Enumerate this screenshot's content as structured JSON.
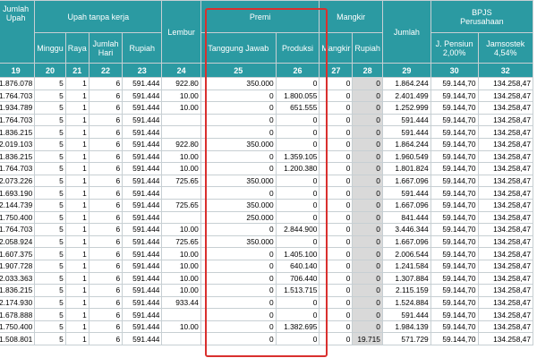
{
  "headers": {
    "jumlah_upah": "Jumlah\nUpah",
    "upah_tanpa_kerja": "Upah tanpa kerja",
    "minggu": "Minggu",
    "raya": "Raya",
    "jumlah_hari": "Jumlah\nHari",
    "rupiah": "Rupiah",
    "lembur": "Lembur",
    "premi": "Premi",
    "tanggung_jawab": "Tanggung Jawab",
    "produksi": "Produksi",
    "mangkir_group": "Mangkir",
    "mangkir": "Mangkir",
    "rupiah_mangkir": "Rupiah",
    "jumlah": "Jumlah",
    "bpjs": "BPJS\nPerusahaan",
    "j_pensiun": "J. Pensiun\n2,00%",
    "jamsostek": "Jamsostek\n4,54%"
  },
  "column_numbers": [
    "19",
    "20",
    "21",
    "22",
    "23",
    "24",
    "25",
    "26",
    "27",
    "28",
    "29",
    "30",
    "32"
  ],
  "rows": [
    [
      "1.876.078",
      "5",
      "1",
      "6",
      "591.444",
      "922.80",
      "350.000",
      "0",
      "0",
      "0",
      "1.864.244",
      "59.144,70",
      "134.258,47"
    ],
    [
      "1.764.703",
      "5",
      "1",
      "6",
      "591.444",
      "10.00",
      "0",
      "1.800.055",
      "0",
      "0",
      "2.401.499",
      "59.144,70",
      "134.258,47"
    ],
    [
      "1.934.789",
      "5",
      "1",
      "6",
      "591.444",
      "10.00",
      "0",
      "651.555",
      "0",
      "0",
      "1.252.999",
      "59.144,70",
      "134.258,47"
    ],
    [
      "1.764.703",
      "5",
      "1",
      "6",
      "591.444",
      "",
      "0",
      "0",
      "0",
      "0",
      "591.444",
      "59.144,70",
      "134.258,47"
    ],
    [
      "1.836.215",
      "5",
      "1",
      "6",
      "591.444",
      "",
      "0",
      "0",
      "0",
      "0",
      "591.444",
      "59.144,70",
      "134.258,47"
    ],
    [
      "2.019.103",
      "5",
      "1",
      "6",
      "591.444",
      "922.80",
      "350.000",
      "0",
      "0",
      "0",
      "1.864.244",
      "59.144,70",
      "134.258,47"
    ],
    [
      "1.836.215",
      "5",
      "1",
      "6",
      "591.444",
      "10.00",
      "0",
      "1.359.105",
      "0",
      "0",
      "1.960.549",
      "59.144,70",
      "134.258,47"
    ],
    [
      "1.764.703",
      "5",
      "1",
      "6",
      "591.444",
      "10.00",
      "0",
      "1.200.380",
      "0",
      "0",
      "1.801.824",
      "59.144,70",
      "134.258,47"
    ],
    [
      "2.073.226",
      "5",
      "1",
      "6",
      "591.444",
      "725.65",
      "350.000",
      "0",
      "0",
      "0",
      "1.667.096",
      "59.144,70",
      "134.258,47"
    ],
    [
      "1.693.190",
      "5",
      "1",
      "6",
      "591.444",
      "",
      "0",
      "0",
      "0",
      "0",
      "591.444",
      "59.144,70",
      "134.258,47"
    ],
    [
      "2.144.739",
      "5",
      "1",
      "6",
      "591.444",
      "725.65",
      "350.000",
      "0",
      "0",
      "0",
      "1.667.096",
      "59.144,70",
      "134.258,47"
    ],
    [
      "1.750.400",
      "5",
      "1",
      "6",
      "591.444",
      "",
      "250.000",
      "0",
      "0",
      "0",
      "841.444",
      "59.144,70",
      "134.258,47"
    ],
    [
      "1.764.703",
      "5",
      "1",
      "6",
      "591.444",
      "10.00",
      "0",
      "2.844.900",
      "0",
      "0",
      "3.446.344",
      "59.144,70",
      "134.258,47"
    ],
    [
      "2.058.924",
      "5",
      "1",
      "6",
      "591.444",
      "725.65",
      "350.000",
      "0",
      "0",
      "0",
      "1.667.096",
      "59.144,70",
      "134.258,47"
    ],
    [
      "1.607.375",
      "5",
      "1",
      "6",
      "591.444",
      "10.00",
      "0",
      "1.405.100",
      "0",
      "0",
      "2.006.544",
      "59.144,70",
      "134.258,47"
    ],
    [
      "1.907.728",
      "5",
      "1",
      "6",
      "591.444",
      "10.00",
      "0",
      "640.140",
      "0",
      "0",
      "1.241.584",
      "59.144,70",
      "134.258,47"
    ],
    [
      "2.033.363",
      "5",
      "1",
      "6",
      "591.444",
      "10.00",
      "0",
      "706.440",
      "0",
      "0",
      "1.307.884",
      "59.144,70",
      "134.258,47"
    ],
    [
      "1.836.215",
      "5",
      "1",
      "6",
      "591.444",
      "10.00",
      "0",
      "1.513.715",
      "0",
      "0",
      "2.115.159",
      "59.144,70",
      "134.258,47"
    ],
    [
      "2.174.930",
      "5",
      "1",
      "6",
      "591.444",
      "933.44",
      "0",
      "0",
      "0",
      "0",
      "1.524.884",
      "59.144,70",
      "134.258,47"
    ],
    [
      "1.678.888",
      "5",
      "1",
      "6",
      "591.444",
      "",
      "0",
      "0",
      "0",
      "0",
      "591.444",
      "59.144,70",
      "134.258,47"
    ],
    [
      "1.750.400",
      "5",
      "1",
      "6",
      "591.444",
      "10.00",
      "0",
      "1.382.695",
      "0",
      "0",
      "1.984.139",
      "59.144,70",
      "134.258,47"
    ],
    [
      "1.508.801",
      "5",
      "1",
      "6",
      "591.444",
      "",
      "0",
      "0",
      "0",
      "19.715",
      "571.729",
      "59.144,70",
      "134.258,47"
    ]
  ],
  "colors": {
    "header_bg": "#2b9aa2",
    "header_text": "#ffffff",
    "highlight_border": "#d9302e",
    "shaded_cell": "#d9d9d9"
  }
}
